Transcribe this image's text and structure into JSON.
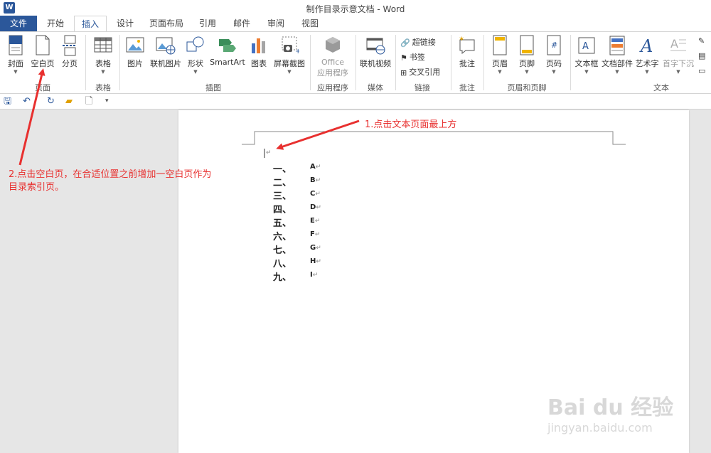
{
  "window": {
    "title": "制作目录示意文档 - Word",
    "logo": "W"
  },
  "tabs": [
    {
      "label": "文件"
    },
    {
      "label": "开始"
    },
    {
      "label": "插入"
    },
    {
      "label": "设计"
    },
    {
      "label": "页面布局"
    },
    {
      "label": "引用"
    },
    {
      "label": "邮件"
    },
    {
      "label": "审阅"
    },
    {
      "label": "视图"
    }
  ],
  "active_tab": "插入",
  "ribbon": {
    "pages": {
      "cover": "封面",
      "blank": "空白页",
      "break": "分页",
      "group": "页面"
    },
    "tables": {
      "table": "表格",
      "group": "表格"
    },
    "illustrations": {
      "picture": "图片",
      "online_picture": "联机图片",
      "shapes": "形状",
      "smartart": "SmartArt",
      "chart": "图表",
      "screenshot": "屏幕截图",
      "group": "插图"
    },
    "apps": {
      "office_line1": "Office",
      "office_line2": "应用程序",
      "group": "应用程序"
    },
    "media": {
      "online_video": "联机视频",
      "group": "媒体"
    },
    "links": {
      "hyperlink": "超链接",
      "bookmark": "书签",
      "cross_ref": "交叉引用",
      "group": "链接"
    },
    "comments": {
      "comment": "批注",
      "group": "批注"
    },
    "header_footer": {
      "header": "页眉",
      "footer": "页脚",
      "page_number": "页码",
      "group": "页眉和页脚"
    },
    "text": {
      "textbox": "文本框",
      "quick_parts": "文档部件",
      "wordart": "艺术字",
      "dropcap": "首字下沉",
      "group": "文本"
    }
  },
  "document": {
    "items": [
      {
        "num": "一、",
        "letter": "A"
      },
      {
        "num": "二、",
        "letter": "B"
      },
      {
        "num": "三、",
        "letter": "C"
      },
      {
        "num": "四、",
        "letter": "D"
      },
      {
        "num": "五、",
        "letter": "E"
      },
      {
        "num": "六、",
        "letter": "F"
      },
      {
        "num": "七、",
        "letter": "G"
      },
      {
        "num": "八、",
        "letter": "H"
      },
      {
        "num": "九、",
        "letter": "I"
      }
    ]
  },
  "annotations": {
    "step1": "1.点击文本页面最上方",
    "step2_line1": "2.点击空白页，在合适位置之前增加一空白页作为",
    "step2_line2": "目录索引页。",
    "color": "#e8302f"
  },
  "watermark": {
    "brand": "Bai du 经验",
    "url": "jingyan.baidu.com"
  },
  "colors": {
    "accent": "#2b579a",
    "annotation": "#e8302f"
  }
}
